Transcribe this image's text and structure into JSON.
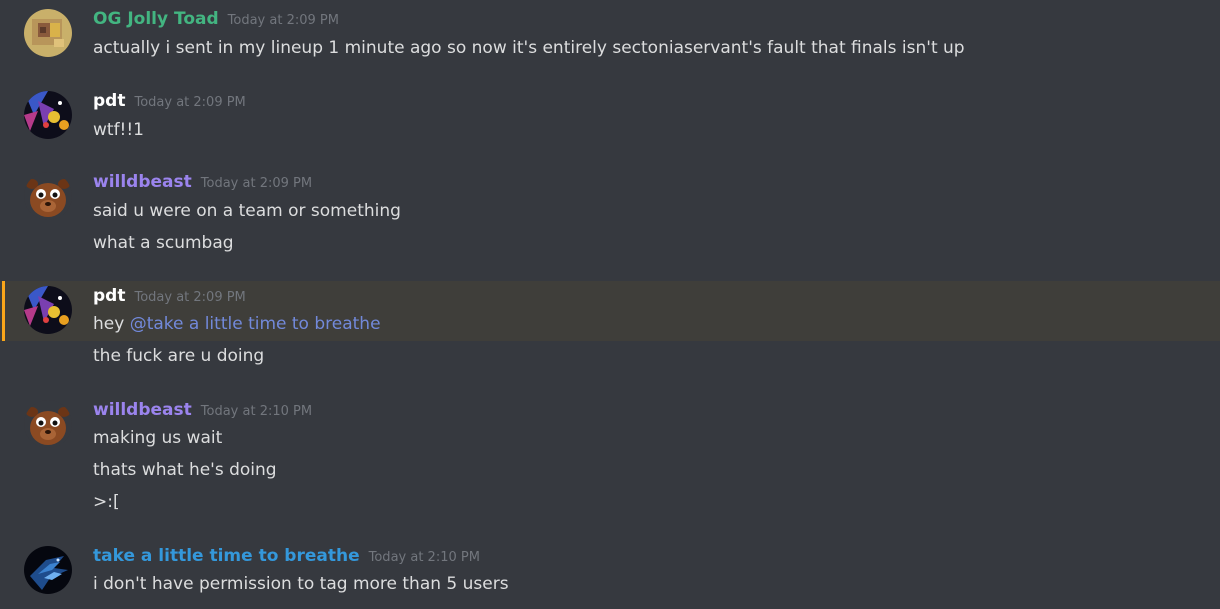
{
  "messages": [
    {
      "author": "OG Jolly Toad",
      "author_color": "#43b581",
      "timestamp": "Today at 2:09 PM",
      "avatar_icon": "blurred-toad-avatar",
      "lines": [
        "actually i sent in my lineup 1 minute ago so now it's entirely sectoniaservant's fault that finals isn't up"
      ]
    },
    {
      "author": "pdt",
      "author_color": "#ffffff",
      "timestamp": "Today at 2:09 PM",
      "avatar_icon": "colorful-space-avatar",
      "lines": [
        "wtf!!1"
      ]
    },
    {
      "author": "willdbeast",
      "author_color": "#9b84ee",
      "timestamp": "Today at 2:09 PM",
      "avatar_icon": "brown-beast-avatar",
      "lines": [
        "said u were on a team or something",
        "what a scumbag"
      ]
    },
    {
      "author": "pdt",
      "author_color": "#ffffff",
      "timestamp": "Today at 2:09 PM",
      "avatar_icon": "colorful-space-avatar",
      "mention_prefix": "hey ",
      "mention": "@take a little time to breathe",
      "lines": [
        "the fuck are u doing"
      ]
    },
    {
      "author": "willdbeast",
      "author_color": "#9b84ee",
      "timestamp": "Today at 2:10 PM",
      "avatar_icon": "brown-beast-avatar",
      "lines": [
        "making us wait",
        "thats what he's doing",
        ">:["
      ]
    },
    {
      "author": "take a little time to breathe",
      "author_color": "#3498db",
      "timestamp": "Today at 2:10 PM",
      "avatar_icon": "blue-dragon-avatar",
      "lines": [
        "i don't have permission to tag more than 5 users"
      ]
    }
  ],
  "colors": {
    "background": "#36393f",
    "message_text": "#dcddde",
    "timestamp": "#72767d",
    "mention": "#7289da",
    "mention_highlight_bar": "#faa61a",
    "mention_highlight_bg": "#3f3e3a"
  }
}
